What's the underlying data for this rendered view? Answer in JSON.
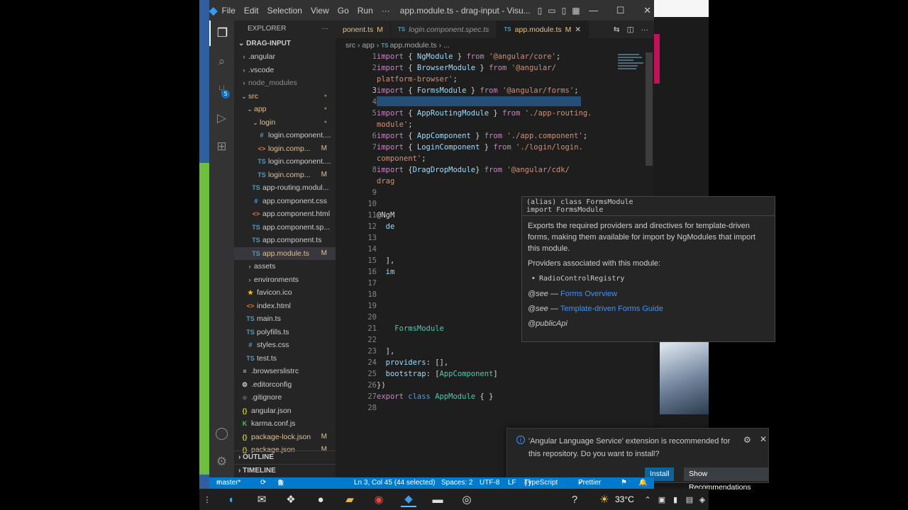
{
  "window": {
    "menus": [
      "File",
      "Edit",
      "Selection",
      "View",
      "Go",
      "Run",
      "···"
    ],
    "title": "app.module.ts - drag-input - Visu..."
  },
  "sidebar": {
    "title": "EXPLORER",
    "root": "DRAG-INPUT",
    "tree": [
      {
        "label": ".angular",
        "kind": "folder",
        "indent": 1
      },
      {
        "label": ".vscode",
        "kind": "folder",
        "indent": 1
      },
      {
        "label": "node_modules",
        "kind": "folder",
        "indent": 1,
        "dim": true
      },
      {
        "label": "src",
        "kind": "folder-open",
        "indent": 1,
        "modified": true,
        "dot": true
      },
      {
        "label": "app",
        "kind": "folder-open",
        "indent": 2,
        "modified": true,
        "dot": true
      },
      {
        "label": "login",
        "kind": "folder-open",
        "indent": 3,
        "modified": true,
        "dot": true
      },
      {
        "label": "login.component....",
        "kind": "css",
        "indent": 4
      },
      {
        "label": "login.comp...",
        "kind": "html",
        "indent": 4,
        "modified": true,
        "status": "M"
      },
      {
        "label": "login.component....",
        "kind": "ts",
        "indent": 4
      },
      {
        "label": "login.comp...",
        "kind": "ts",
        "indent": 4,
        "modified": true,
        "status": "M"
      },
      {
        "label": "app-routing.modul...",
        "kind": "ts",
        "indent": 3
      },
      {
        "label": "app.component.css",
        "kind": "css",
        "indent": 3
      },
      {
        "label": "app.component.html",
        "kind": "html",
        "indent": 3
      },
      {
        "label": "app.component.sp...",
        "kind": "ts",
        "indent": 3
      },
      {
        "label": "app.component.ts",
        "kind": "ts",
        "indent": 3
      },
      {
        "label": "app.module.ts",
        "kind": "ts",
        "indent": 3,
        "modified": true,
        "status": "M",
        "selected": true
      },
      {
        "label": "assets",
        "kind": "folder",
        "indent": 2
      },
      {
        "label": "environments",
        "kind": "folder",
        "indent": 2
      },
      {
        "label": "favicon.ico",
        "kind": "star",
        "indent": 2
      },
      {
        "label": "index.html",
        "kind": "html",
        "indent": 2
      },
      {
        "label": "main.ts",
        "kind": "ts",
        "indent": 2
      },
      {
        "label": "polyfills.ts",
        "kind": "ts",
        "indent": 2
      },
      {
        "label": "styles.css",
        "kind": "css",
        "indent": 2
      },
      {
        "label": "test.ts",
        "kind": "ts",
        "indent": 2
      },
      {
        "label": ".browserslistrc",
        "kind": "file",
        "indent": 1
      },
      {
        "label": ".editorconfig",
        "kind": "gear",
        "indent": 1
      },
      {
        "label": ".gitignore",
        "kind": "git",
        "indent": 1
      },
      {
        "label": "angular.json",
        "kind": "json",
        "indent": 1
      },
      {
        "label": "karma.conf.js",
        "kind": "karma",
        "indent": 1
      },
      {
        "label": "package-lock.json",
        "kind": "json",
        "indent": 1,
        "modified": true,
        "status": "M"
      },
      {
        "label": "package.json",
        "kind": "json",
        "indent": 1,
        "modified": true,
        "status": "M"
      }
    ],
    "outline": "OUTLINE",
    "timeline": "TIMELINE"
  },
  "tabs": [
    {
      "label": "ponent.ts",
      "status": "M",
      "active": false,
      "italic": false
    },
    {
      "label": "login.component.spec.ts",
      "status": "",
      "active": false,
      "italic": true
    },
    {
      "label": "app.module.ts",
      "status": "M",
      "active": true,
      "italic": false
    }
  ],
  "breadcrumb": [
    "src",
    "app",
    "app.module.ts",
    "..."
  ],
  "code": {
    "line_numbers": [
      "1",
      "2",
      "",
      "3",
      "4",
      "5",
      "",
      "6",
      "7",
      "",
      "8",
      "",
      "9",
      "10",
      "11",
      "12",
      "13",
      "14",
      "15",
      "16",
      "17",
      "18",
      "19",
      "20",
      "21",
      "22",
      "23",
      "24",
      "25",
      "26",
      "27",
      "28"
    ],
    "current_line": "3",
    "lines": [
      [
        [
          "kw",
          "import"
        ],
        [
          "pn",
          " { "
        ],
        [
          "vr",
          "NgModule"
        ],
        [
          "pn",
          " } "
        ],
        [
          "kw",
          "from"
        ],
        [
          "st",
          " '@angular/core'"
        ],
        [
          "pn",
          ";"
        ]
      ],
      [
        [
          "kw",
          "import"
        ],
        [
          "pn",
          " { "
        ],
        [
          "vr",
          "BrowserModule"
        ],
        [
          "pn",
          " } "
        ],
        [
          "kw",
          "from"
        ],
        [
          "st",
          " '@angular/"
        ]
      ],
      [
        [
          "st",
          "platform-browser'"
        ],
        [
          "pn",
          ";"
        ]
      ],
      [
        [
          "kw",
          "import"
        ],
        [
          "pn",
          " { "
        ],
        [
          "vr",
          "FormsModule"
        ],
        [
          "pn",
          " } "
        ],
        [
          "kw",
          "from"
        ],
        [
          "st",
          " '@angular/forms'"
        ],
        [
          "pn",
          ";"
        ]
      ],
      [],
      [
        [
          "kw",
          "import"
        ],
        [
          "pn",
          " { "
        ],
        [
          "vr",
          "AppRoutingModule"
        ],
        [
          "pn",
          " } "
        ],
        [
          "kw",
          "from"
        ],
        [
          "st",
          " './app-routing."
        ]
      ],
      [
        [
          "st",
          "module'"
        ],
        [
          "pn",
          ";"
        ]
      ],
      [
        [
          "kw",
          "import"
        ],
        [
          "pn",
          " { "
        ],
        [
          "vr",
          "AppComponent"
        ],
        [
          "pn",
          " } "
        ],
        [
          "kw",
          "from"
        ],
        [
          "st",
          " './app.component'"
        ],
        [
          "pn",
          ";"
        ]
      ],
      [
        [
          "kw",
          "import"
        ],
        [
          "pn",
          " { "
        ],
        [
          "vr",
          "LoginComponent"
        ],
        [
          "pn",
          " } "
        ],
        [
          "kw",
          "from"
        ],
        [
          "st",
          " './login/login."
        ]
      ],
      [
        [
          "st",
          "component'"
        ],
        [
          "pn",
          ";"
        ]
      ],
      [
        [
          "kw",
          "import"
        ],
        [
          "pn",
          " {"
        ],
        [
          "vr",
          "DragDropModule"
        ],
        [
          "pn",
          "} "
        ],
        [
          "kw",
          "from"
        ],
        [
          "st",
          " '@angular/cdk/"
        ]
      ],
      [
        [
          "st",
          "drag"
        ]
      ],
      [],
      [],
      [
        [
          "pn",
          "@NgM"
        ]
      ],
      [
        [
          "pn",
          "  "
        ],
        [
          "vr",
          "de"
        ]
      ],
      [],
      [],
      [
        [
          "pn",
          "  ],"
        ]
      ],
      [
        [
          "pn",
          "  "
        ],
        [
          "vr",
          "im"
        ]
      ],
      [],
      [],
      [],
      [],
      [
        [
          "pn",
          "    "
        ],
        [
          "ty",
          "FormsModule"
        ]
      ],
      [],
      [
        [
          "pn",
          "  ],"
        ]
      ],
      [
        [
          "pn",
          "  "
        ],
        [
          "vr",
          "providers"
        ],
        [
          "pn",
          ": [],"
        ]
      ],
      [
        [
          "pn",
          "  "
        ],
        [
          "vr",
          "bootstrap"
        ],
        [
          "pn",
          ": ["
        ],
        [
          "ty",
          "AppComponent"
        ],
        [
          "pn",
          "]"
        ]
      ],
      [
        [
          "pn",
          "})"
        ]
      ],
      [
        [
          "kw",
          "export"
        ],
        [
          "bl",
          " class "
        ],
        [
          "ty",
          "AppModule"
        ],
        [
          "pn",
          " { }"
        ]
      ],
      []
    ]
  },
  "hover": {
    "sig1": "(alias) class FormsModule",
    "sig2": "import FormsModule",
    "desc": "Exports the required providers and directives for template-driven forms, making them available for import by NgModules that import this module.",
    "providers_label": "Providers associated with this module:",
    "provider_item": "RadioControlRegistry",
    "see1_prefix": "@see —",
    "see1_link": "Forms Overview",
    "see2_prefix": "@see —",
    "see2_link": "Template-driven Forms Guide",
    "public_api": "@publicApi"
  },
  "toast": {
    "message": "'Angular Language Service' extension is recommended for this repository. Do you want to install?",
    "install": "Install",
    "show_recommendations": "Show Recommendations"
  },
  "statusbar": {
    "branch": "master*",
    "errors": "0",
    "warnings": "0",
    "position": "Ln 3, Col 45 (44 selected)",
    "spaces": "Spaces: 2",
    "encoding": "UTF-8",
    "eol": "LF",
    "language": "TypeScript",
    "prettier": "Prettier"
  },
  "taskbar": {
    "temperature": "33°C"
  }
}
